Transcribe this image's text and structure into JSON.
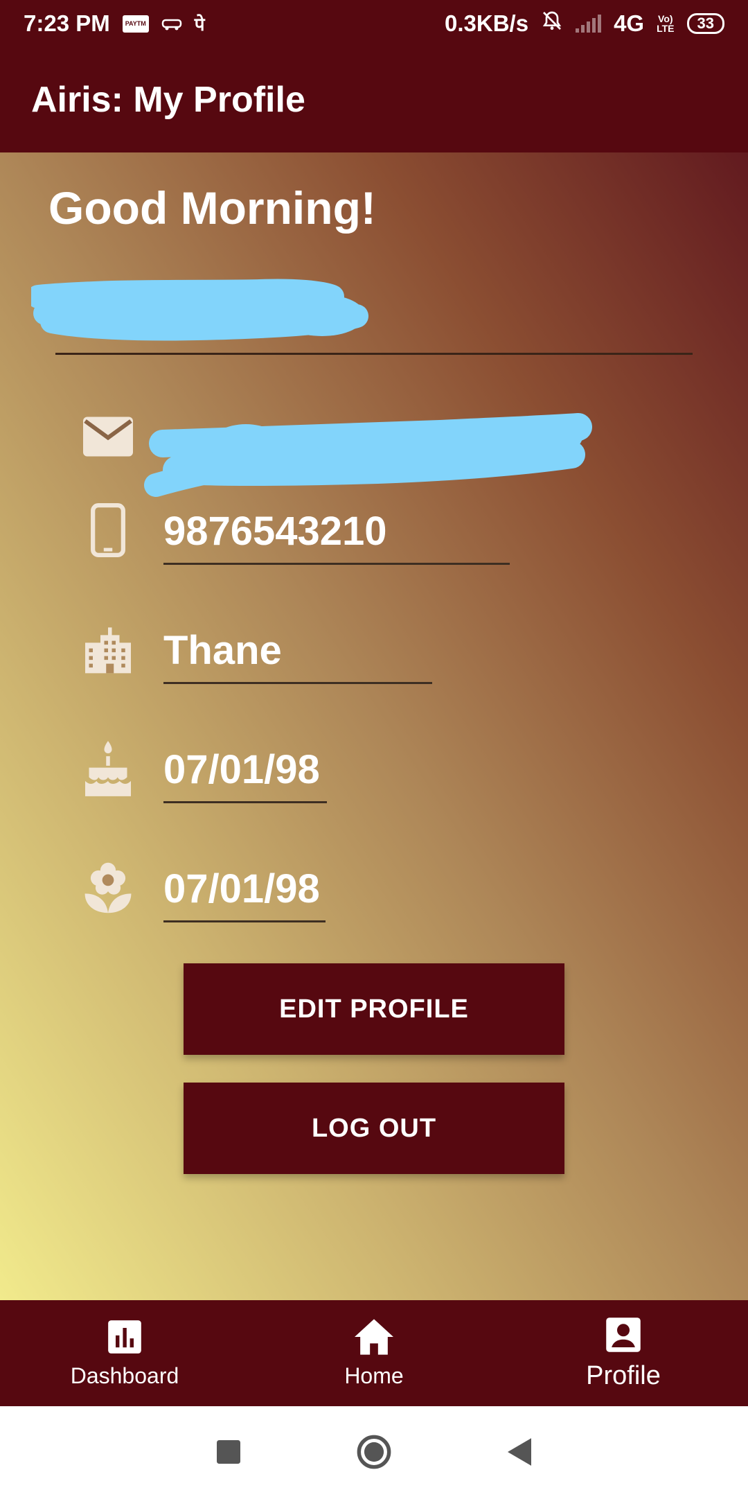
{
  "status_bar": {
    "time": "7:23 PM",
    "paytm_icon_text": "PAYTM",
    "devanagari_icon": "पे",
    "net_speed": "0.3KB/s",
    "network": "4G",
    "volte_top": "Vo)",
    "volte_bottom": "LTE",
    "battery": "33"
  },
  "app_bar": {
    "title": "Airis: My Profile"
  },
  "profile": {
    "greeting": "Good Morning!",
    "name": "",
    "email": "",
    "phone": "9876543210",
    "city": "Thane",
    "birthday": "07/01/98",
    "anniversary": "07/01/98"
  },
  "buttons": {
    "edit": "EDIT PROFILE",
    "logout": "LOG OUT"
  },
  "bottom_nav": [
    {
      "label": "Dashboard",
      "icon": "bar-chart-icon"
    },
    {
      "label": "Home",
      "icon": "home-icon"
    },
    {
      "label": "Profile",
      "icon": "account-box-icon"
    }
  ],
  "colors": {
    "primary": "#560810",
    "icon_tint": "#f1e6d8",
    "redaction": "#82d4fb"
  }
}
